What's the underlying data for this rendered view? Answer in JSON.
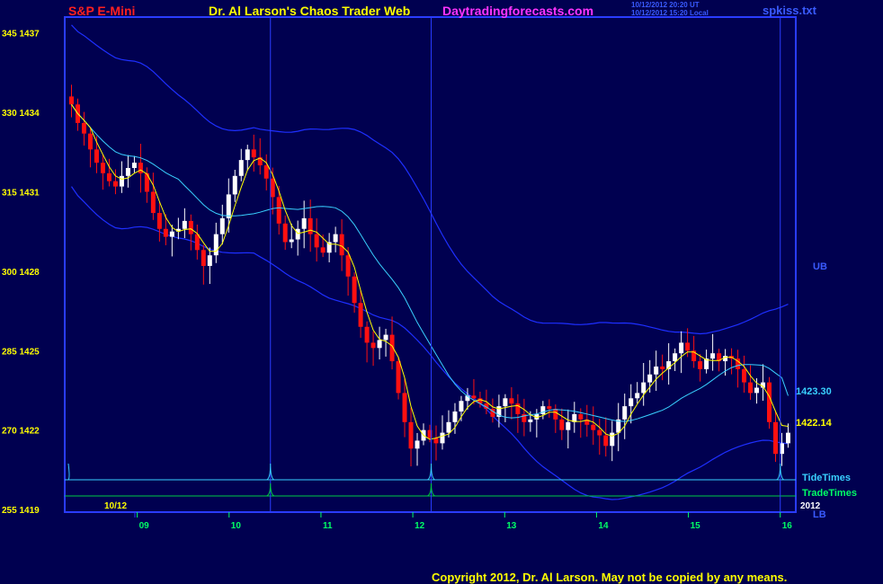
{
  "header": {
    "symbol": "S&P E-Mini",
    "title": "Dr. Al Larson's Chaos Trader Web",
    "site": "Daytradingforecasts.com",
    "timestamp_ut": "10/12/2012 20:20 UT",
    "timestamp_local": "10/12/2012 15:20 Local",
    "file": "spkiss.txt"
  },
  "footer": {
    "copyright": "Copyright 2012, Dr. Al Larson. May not be copied by any means."
  },
  "colors": {
    "background": "#000050",
    "frame": "#2a3cff",
    "bull_candle": "#ffffff",
    "bear_candle": "#ff1010",
    "fast_ma": "#ffff00",
    "mid_ma": "#39d0ff",
    "band": "#1e2fff",
    "tide_times": "#39d0ff",
    "trade_times": "#00cc44",
    "left_labels": "#ffff00",
    "date_labels": "#00ff66"
  },
  "chart_data": {
    "type": "candlestick",
    "y_left_labels": [
      "345 1437",
      "330 1434",
      "315 1431",
      "300 1428",
      "285 1425",
      "270 1422",
      "255 1419"
    ],
    "y_price_ticks": [
      1437,
      1434,
      1431,
      1428,
      1425,
      1422,
      1419
    ],
    "ylim": [
      1419,
      1437
    ],
    "x_date_label": "10/12",
    "x_hour_ticks": [
      "09",
      "10",
      "11",
      "12",
      "13",
      "14",
      "15",
      "16"
    ],
    "right_labels": {
      "upper_band": "UB",
      "lower_band": "LB",
      "mid_value": "1423.30",
      "fast_value": "1422.14",
      "tide_times": "TideTimes",
      "trade_times": "TradeTimes",
      "year": "2012"
    },
    "cycle_marks_hours": [
      10.45,
      12.2,
      16.0
    ],
    "fast_ma_last": 1422.14,
    "mid_ma_last": 1423.3,
    "closes": [
      1434.3,
      1433.6,
      1433.2,
      1432.6,
      1432.1,
      1431.7,
      1431.4,
      1431.2,
      1431.6,
      1431.9,
      1432.1,
      1431.7,
      1431.0,
      1430.2,
      1429.6,
      1429.3,
      1429.5,
      1429.6,
      1429.9,
      1429.4,
      1428.8,
      1428.2,
      1428.6,
      1429.4,
      1430.0,
      1430.9,
      1431.6,
      1432.2,
      1432.6,
      1432.3,
      1432.0,
      1431.5,
      1430.8,
      1429.8,
      1429.1,
      1429.2,
      1429.6,
      1430.0,
      1429.4,
      1428.9,
      1428.7,
      1429.1,
      1429.4,
      1428.6,
      1427.8,
      1426.8,
      1425.9,
      1425.3,
      1425.1,
      1425.4,
      1425.6,
      1424.6,
      1423.4,
      1422.3,
      1421.3,
      1421.6,
      1422.0,
      1421.7,
      1421.5,
      1421.9,
      1422.3,
      1422.7,
      1423.1,
      1423.3,
      1423.2,
      1423.0,
      1422.8,
      1422.5,
      1422.9,
      1423.2,
      1423.0,
      1422.6,
      1422.3,
      1422.4,
      1422.6,
      1422.9,
      1422.8,
      1422.4,
      1422.0,
      1422.3,
      1422.6,
      1422.4,
      1422.2,
      1422.0,
      1421.8,
      1421.4,
      1421.9,
      1422.4,
      1422.9,
      1423.2,
      1423.4,
      1423.8,
      1424.1,
      1424.4,
      1424.3,
      1424.6,
      1424.9,
      1425.3,
      1425.0,
      1424.6,
      1424.3,
      1424.7,
      1424.9,
      1424.6,
      1424.8,
      1424.7,
      1424.3,
      1423.8,
      1423.4,
      1423.6,
      1423.8,
      1422.3,
      1421.1,
      1421.5,
      1421.9
    ]
  }
}
